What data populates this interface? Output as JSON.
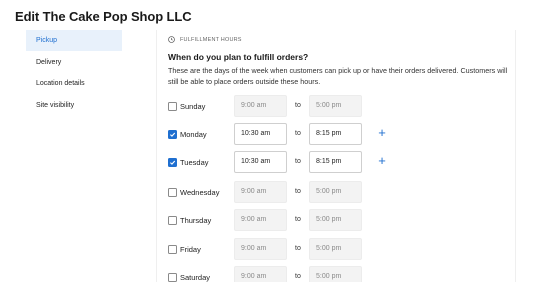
{
  "page": {
    "title": "Edit The Cake Pop Shop LLC"
  },
  "sidebar": {
    "items": [
      {
        "label": "Pickup",
        "active": true
      },
      {
        "label": "Delivery",
        "active": false
      },
      {
        "label": "Location details",
        "active": false
      },
      {
        "label": "Site visibility",
        "active": false
      }
    ]
  },
  "section": {
    "label": "FULFILLMENT HOURS",
    "icon": "clock-icon",
    "question": "When do you plan to fulfill orders?",
    "description": "These are the days of the week when customers can pick up or have their orders delivered. Customers will still be able to place orders outside these hours."
  },
  "hours": {
    "to_label": "to",
    "add_icon": "plus-icon",
    "accent_color": "#1f6fd0",
    "days": [
      {
        "day": "Sunday",
        "checked": false,
        "open": "9:00 am",
        "close": "5:00 pm"
      },
      {
        "day": "Monday",
        "checked": true,
        "open": "10:30 am",
        "close": "8:15 pm"
      },
      {
        "day": "Tuesday",
        "checked": true,
        "open": "10:30 am",
        "close": "8:15 pm"
      },
      {
        "day": "Wednesday",
        "checked": false,
        "open": "9:00 am",
        "close": "5:00 pm"
      },
      {
        "day": "Thursday",
        "checked": false,
        "open": "9:00 am",
        "close": "5:00 pm"
      },
      {
        "day": "Friday",
        "checked": false,
        "open": "9:00 am",
        "close": "5:00 pm"
      },
      {
        "day": "Saturday",
        "checked": false,
        "open": "9:00 am",
        "close": "5:00 pm"
      }
    ]
  }
}
